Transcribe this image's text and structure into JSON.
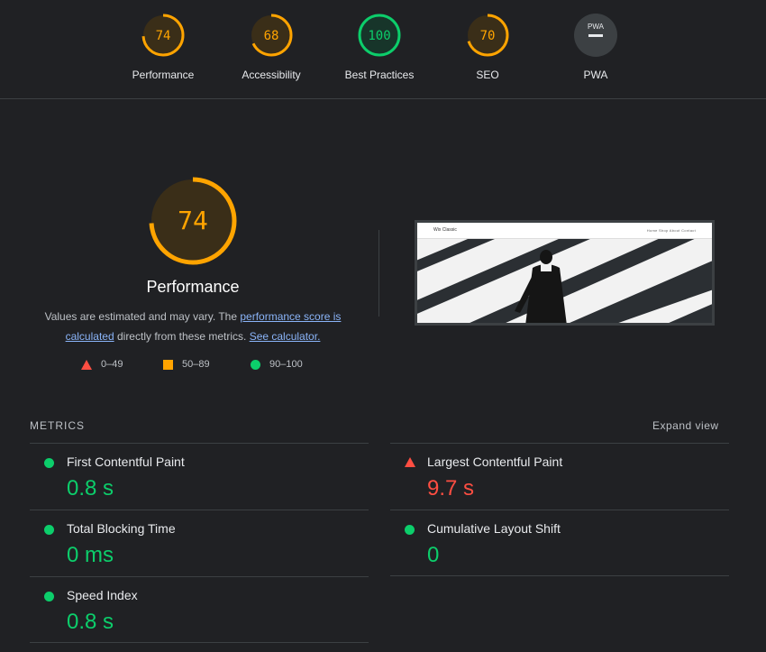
{
  "colors": {
    "good": "#0cce6b",
    "average": "#ffa400",
    "poor": "#ff4e42",
    "link": "#8ab4f8"
  },
  "gauges": [
    {
      "score": "74",
      "label": "Performance",
      "fraction": 0.74,
      "status": "average"
    },
    {
      "score": "68",
      "label": "Accessibility",
      "fraction": 0.68,
      "status": "average"
    },
    {
      "score": "100",
      "label": "Best Practices",
      "fraction": 1.0,
      "status": "good"
    },
    {
      "score": "70",
      "label": "SEO",
      "fraction": 0.7,
      "status": "average"
    },
    {
      "score": "PWA",
      "label": "PWA",
      "fraction": 0,
      "status": "na"
    }
  ],
  "performance": {
    "score": "74",
    "fraction": 0.74,
    "title": "Performance",
    "desc_prefix": "Values are estimated and may vary. The ",
    "link1": "performance score is calculated",
    "desc_middle": " directly from these metrics. ",
    "link2": "See calculator."
  },
  "legend": {
    "poor": "0–49",
    "average": "50–89",
    "good": "90–100"
  },
  "thumbnail": {
    "brand": "Wix Classic",
    "nav": "Home   Shop   About   Contact"
  },
  "metrics": {
    "title": "METRICS",
    "expand": "Expand view",
    "fcp": {
      "label": "First Contentful Paint",
      "value": "0.8 s",
      "status": "good"
    },
    "lcp": {
      "label": "Largest Contentful Paint",
      "value": "9.7 s",
      "status": "poor"
    },
    "tbt": {
      "label": "Total Blocking Time",
      "value": "0 ms",
      "status": "good"
    },
    "cls": {
      "label": "Cumulative Layout Shift",
      "value": "0",
      "status": "good"
    },
    "si": {
      "label": "Speed Index",
      "value": "0.8 s",
      "status": "good"
    }
  }
}
